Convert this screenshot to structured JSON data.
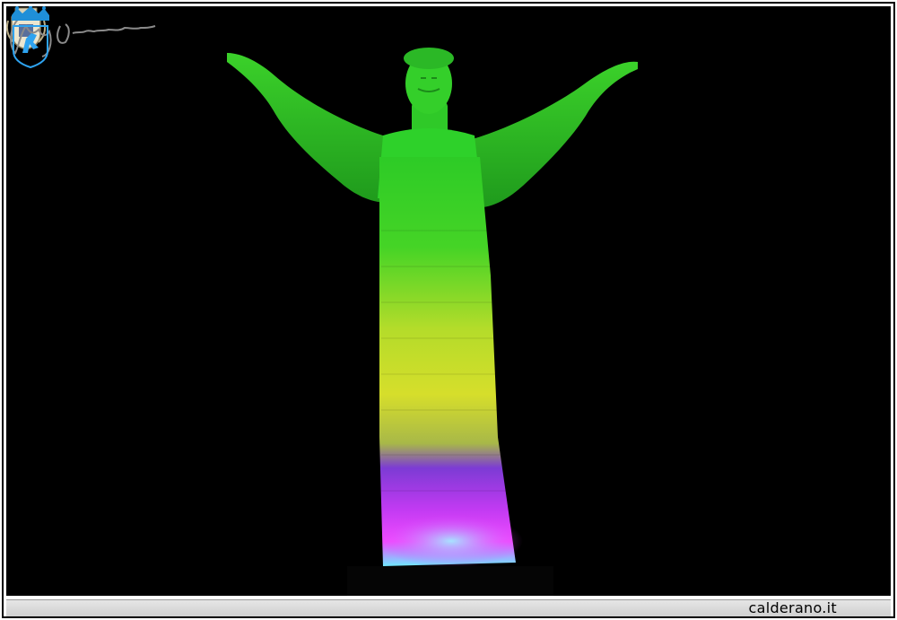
{
  "image": {
    "subject": "illuminated-statue-with-outstretched-arms",
    "background_color": "#000000",
    "illumination_colors": [
      "#2fd22a",
      "#d8e02a",
      "#7a2bd0",
      "#e23aff",
      "#3fe6e6"
    ]
  },
  "caption": {
    "text": "calderano.it"
  },
  "icons": {
    "top_left": "town-crest-icon",
    "bottom_right": "blue-coat-of-arms-icon",
    "bottom_left": "handwritten-signature"
  }
}
